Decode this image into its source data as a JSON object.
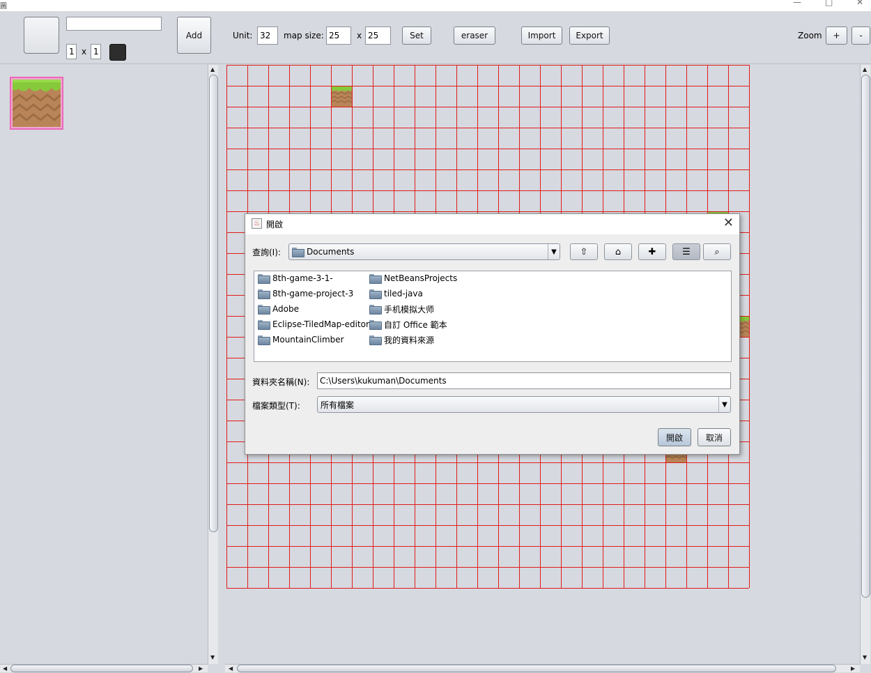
{
  "window": {
    "title_glyph": "圖",
    "minimize": "—",
    "maximize": "□",
    "close": "✕"
  },
  "toolbar": {
    "name_value": "",
    "tile_w": "1",
    "tile_h": "1",
    "times": "x",
    "add_label": "Add",
    "unit_label": "Unit:",
    "unit_value": "32",
    "map_size_label": "map size:",
    "map_w": "25",
    "map_h": "25",
    "set_label": "Set",
    "eraser_label": "eraser",
    "import_label": "Import",
    "export_label": "Export",
    "zoom_label": "Zoom",
    "zoom_in": "+",
    "zoom_out": "-"
  },
  "map": {
    "cols": 25,
    "rows": 25,
    "grid_color": "#e01c1c",
    "tiles_visible": [
      [
        5,
        1
      ],
      [
        23,
        7
      ],
      [
        24,
        12
      ],
      [
        21,
        18
      ]
    ]
  },
  "dialog": {
    "title": "開啟",
    "close_glyph": "✕",
    "look_in_label": "查詢(I):",
    "look_in_value": "Documents",
    "caret": "▼",
    "tool_icons": [
      "up-folder-icon",
      "home-icon",
      "new-folder-icon",
      "list-view-icon",
      "details-view-icon"
    ],
    "tool_glyphs": [
      "⇧",
      "⌂",
      "✚",
      "☰",
      "⌕"
    ],
    "files": [
      "8th-game-3-1-",
      "8th-game-project-3",
      "Adobe",
      "Eclipse-TiledMap-editor",
      "MountainClimber",
      "NetBeansProjects",
      "tiled-java",
      "手机模拟大师",
      "自訂 Office 範本",
      "我的資料來源"
    ],
    "folder_name_label": "資料夾名稱(N):",
    "folder_name_value": "C:\\Users\\kukuman\\Documents",
    "file_type_label": "檔案類型(T):",
    "file_type_value": "所有檔案",
    "open_label": "開啟",
    "cancel_label": "取消"
  }
}
